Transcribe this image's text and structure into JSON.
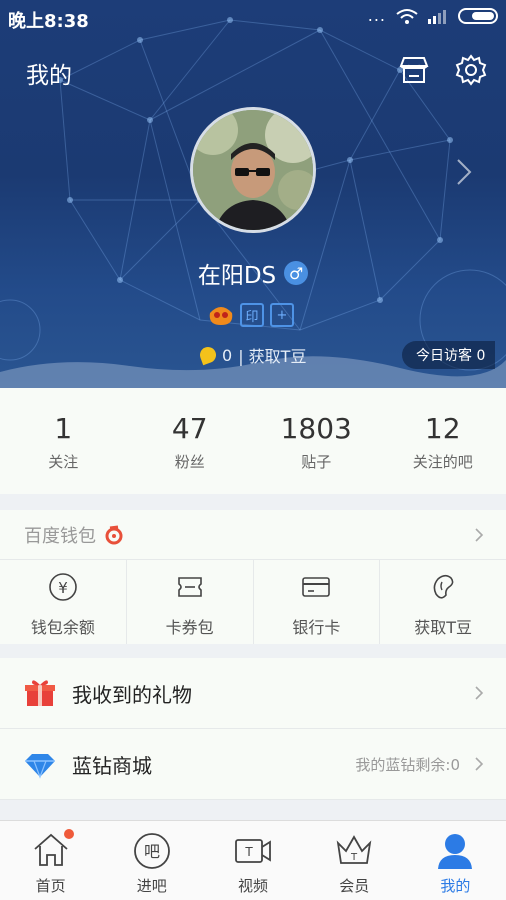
{
  "status": {
    "time": "晚上8:38",
    "dots": "..."
  },
  "header": {
    "title": "我的"
  },
  "profile": {
    "username": "在阳DS",
    "gender_symbol": "♂",
    "badge_yin": "印",
    "badge_plus": "+",
    "tbean_count": "0",
    "tbean_action": "| 获取T豆",
    "visitors_label": "今日访客 0"
  },
  "stats": [
    {
      "num": "1",
      "label": "关注"
    },
    {
      "num": "47",
      "label": "粉丝"
    },
    {
      "num": "1803",
      "label": "贴子"
    },
    {
      "num": "12",
      "label": "关注的吧"
    }
  ],
  "wallet": {
    "title": "百度钱包",
    "items": [
      {
        "label": "钱包余额",
        "icon": "yuan-icon"
      },
      {
        "label": "卡券包",
        "icon": "ticket-icon"
      },
      {
        "label": "银行卡",
        "icon": "bank-card-icon"
      },
      {
        "label": "获取T豆",
        "icon": "bean-icon"
      }
    ]
  },
  "list": [
    {
      "label": "我收到的礼物",
      "icon": "gift-icon",
      "right": ""
    },
    {
      "label": "蓝钻商城",
      "icon": "diamond-icon",
      "right": "我的蓝钻剩余:0"
    }
  ],
  "tabs": [
    {
      "label": "首页",
      "icon": "home-icon"
    },
    {
      "label": "进吧",
      "icon": "ba-icon",
      "glyph": "吧"
    },
    {
      "label": "视频",
      "icon": "video-icon",
      "glyph": "T"
    },
    {
      "label": "会员",
      "icon": "crown-icon",
      "glyph": "T"
    },
    {
      "label": "我的",
      "icon": "person-icon"
    }
  ],
  "colors": {
    "accent": "#2c7be5",
    "header": "#1d3d78",
    "red_dot": "#ef5a3a",
    "gift": "#e8403a",
    "diamond": "#2f86e8"
  }
}
